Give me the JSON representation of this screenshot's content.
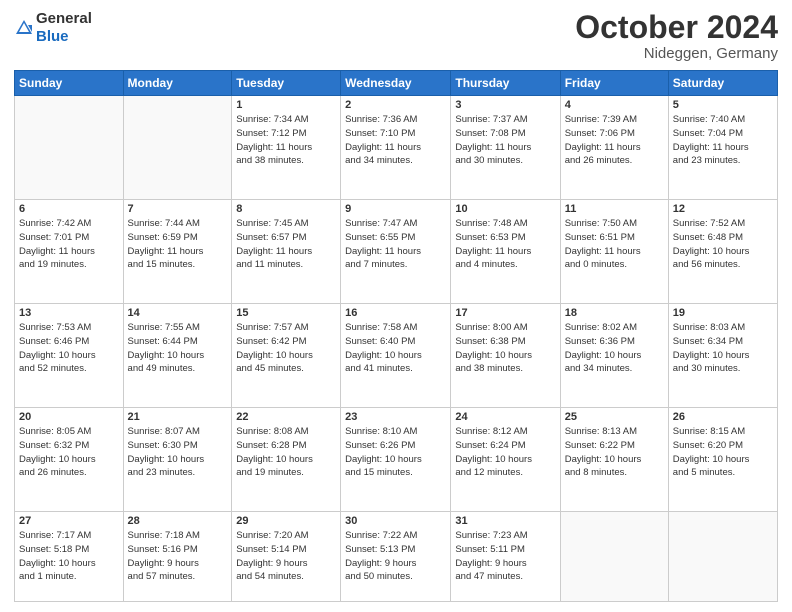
{
  "logo": {
    "general": "General",
    "blue": "Blue"
  },
  "header": {
    "month": "October 2024",
    "location": "Nideggen, Germany"
  },
  "days_of_week": [
    "Sunday",
    "Monday",
    "Tuesday",
    "Wednesday",
    "Thursday",
    "Friday",
    "Saturday"
  ],
  "weeks": [
    {
      "days": [
        {
          "num": "",
          "info": ""
        },
        {
          "num": "",
          "info": ""
        },
        {
          "num": "1",
          "info": "Sunrise: 7:34 AM\nSunset: 7:12 PM\nDaylight: 11 hours\nand 38 minutes."
        },
        {
          "num": "2",
          "info": "Sunrise: 7:36 AM\nSunset: 7:10 PM\nDaylight: 11 hours\nand 34 minutes."
        },
        {
          "num": "3",
          "info": "Sunrise: 7:37 AM\nSunset: 7:08 PM\nDaylight: 11 hours\nand 30 minutes."
        },
        {
          "num": "4",
          "info": "Sunrise: 7:39 AM\nSunset: 7:06 PM\nDaylight: 11 hours\nand 26 minutes."
        },
        {
          "num": "5",
          "info": "Sunrise: 7:40 AM\nSunset: 7:04 PM\nDaylight: 11 hours\nand 23 minutes."
        }
      ]
    },
    {
      "days": [
        {
          "num": "6",
          "info": "Sunrise: 7:42 AM\nSunset: 7:01 PM\nDaylight: 11 hours\nand 19 minutes."
        },
        {
          "num": "7",
          "info": "Sunrise: 7:44 AM\nSunset: 6:59 PM\nDaylight: 11 hours\nand 15 minutes."
        },
        {
          "num": "8",
          "info": "Sunrise: 7:45 AM\nSunset: 6:57 PM\nDaylight: 11 hours\nand 11 minutes."
        },
        {
          "num": "9",
          "info": "Sunrise: 7:47 AM\nSunset: 6:55 PM\nDaylight: 11 hours\nand 7 minutes."
        },
        {
          "num": "10",
          "info": "Sunrise: 7:48 AM\nSunset: 6:53 PM\nDaylight: 11 hours\nand 4 minutes."
        },
        {
          "num": "11",
          "info": "Sunrise: 7:50 AM\nSunset: 6:51 PM\nDaylight: 11 hours\nand 0 minutes."
        },
        {
          "num": "12",
          "info": "Sunrise: 7:52 AM\nSunset: 6:48 PM\nDaylight: 10 hours\nand 56 minutes."
        }
      ]
    },
    {
      "days": [
        {
          "num": "13",
          "info": "Sunrise: 7:53 AM\nSunset: 6:46 PM\nDaylight: 10 hours\nand 52 minutes."
        },
        {
          "num": "14",
          "info": "Sunrise: 7:55 AM\nSunset: 6:44 PM\nDaylight: 10 hours\nand 49 minutes."
        },
        {
          "num": "15",
          "info": "Sunrise: 7:57 AM\nSunset: 6:42 PM\nDaylight: 10 hours\nand 45 minutes."
        },
        {
          "num": "16",
          "info": "Sunrise: 7:58 AM\nSunset: 6:40 PM\nDaylight: 10 hours\nand 41 minutes."
        },
        {
          "num": "17",
          "info": "Sunrise: 8:00 AM\nSunset: 6:38 PM\nDaylight: 10 hours\nand 38 minutes."
        },
        {
          "num": "18",
          "info": "Sunrise: 8:02 AM\nSunset: 6:36 PM\nDaylight: 10 hours\nand 34 minutes."
        },
        {
          "num": "19",
          "info": "Sunrise: 8:03 AM\nSunset: 6:34 PM\nDaylight: 10 hours\nand 30 minutes."
        }
      ]
    },
    {
      "days": [
        {
          "num": "20",
          "info": "Sunrise: 8:05 AM\nSunset: 6:32 PM\nDaylight: 10 hours\nand 26 minutes."
        },
        {
          "num": "21",
          "info": "Sunrise: 8:07 AM\nSunset: 6:30 PM\nDaylight: 10 hours\nand 23 minutes."
        },
        {
          "num": "22",
          "info": "Sunrise: 8:08 AM\nSunset: 6:28 PM\nDaylight: 10 hours\nand 19 minutes."
        },
        {
          "num": "23",
          "info": "Sunrise: 8:10 AM\nSunset: 6:26 PM\nDaylight: 10 hours\nand 15 minutes."
        },
        {
          "num": "24",
          "info": "Sunrise: 8:12 AM\nSunset: 6:24 PM\nDaylight: 10 hours\nand 12 minutes."
        },
        {
          "num": "25",
          "info": "Sunrise: 8:13 AM\nSunset: 6:22 PM\nDaylight: 10 hours\nand 8 minutes."
        },
        {
          "num": "26",
          "info": "Sunrise: 8:15 AM\nSunset: 6:20 PM\nDaylight: 10 hours\nand 5 minutes."
        }
      ]
    },
    {
      "days": [
        {
          "num": "27",
          "info": "Sunrise: 7:17 AM\nSunset: 5:18 PM\nDaylight: 10 hours\nand 1 minute."
        },
        {
          "num": "28",
          "info": "Sunrise: 7:18 AM\nSunset: 5:16 PM\nDaylight: 9 hours\nand 57 minutes."
        },
        {
          "num": "29",
          "info": "Sunrise: 7:20 AM\nSunset: 5:14 PM\nDaylight: 9 hours\nand 54 minutes."
        },
        {
          "num": "30",
          "info": "Sunrise: 7:22 AM\nSunset: 5:13 PM\nDaylight: 9 hours\nand 50 minutes."
        },
        {
          "num": "31",
          "info": "Sunrise: 7:23 AM\nSunset: 5:11 PM\nDaylight: 9 hours\nand 47 minutes."
        },
        {
          "num": "",
          "info": ""
        },
        {
          "num": "",
          "info": ""
        }
      ]
    }
  ]
}
